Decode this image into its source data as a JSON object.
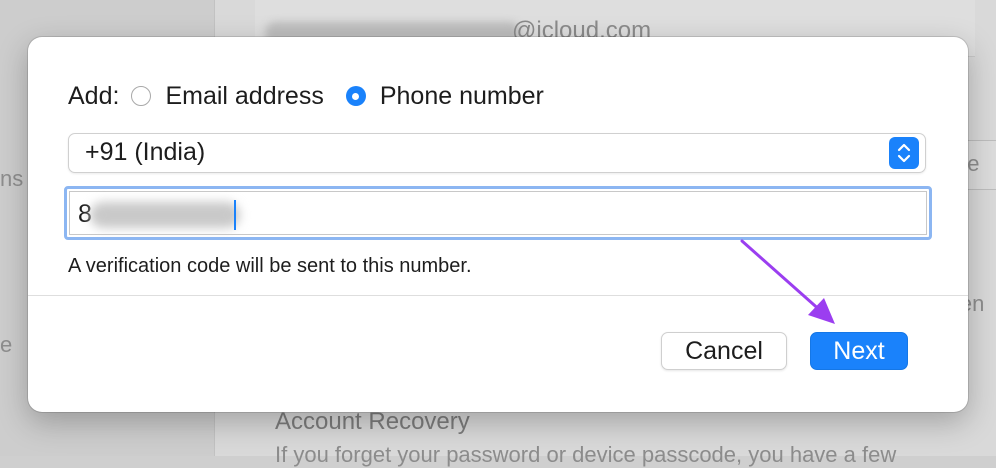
{
  "background": {
    "email_suffix": "@icloud.com",
    "sidebar_fragments": [
      "ns",
      "e"
    ],
    "right_fragments": [
      "ge",
      "len"
    ],
    "section_title": "Account Recovery",
    "section_text": "If you forget your password or device passcode, you have a few"
  },
  "dialog": {
    "add_label": "Add:",
    "options": [
      {
        "label": "Email address",
        "selected": false
      },
      {
        "label": "Phone number",
        "selected": true
      }
    ],
    "country_select": {
      "value": "+91 (India)"
    },
    "phone_input": {
      "visible_prefix": "8"
    },
    "hint": "A verification code will be sent to this number.",
    "buttons": {
      "cancel": "Cancel",
      "next": "Next"
    }
  },
  "colors": {
    "accent": "#1a82fb",
    "focus_ring": "#8cb6f2",
    "annotation_arrow": "#9b3ef0"
  },
  "icons": {
    "stepper": "chevron-up-down-icon",
    "annotation": "arrow-annotation"
  }
}
